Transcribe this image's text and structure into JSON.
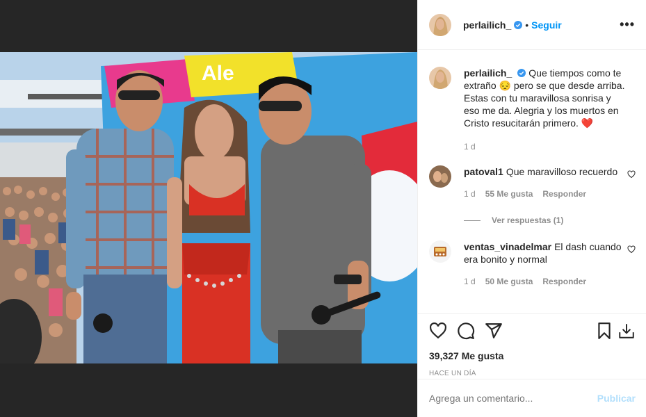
{
  "post": {
    "username": "perlailich_",
    "follow_label": "Seguir",
    "separator": "•",
    "more_label": "•••"
  },
  "caption": {
    "username": "perlailich_",
    "text": "Que tiempos como te extraño 😔 pero se que desde arriba. Estas con tu maravillosa sonrisa y eso me da. Alegria y los muertos en Cristo resucitarán primero. ❤️",
    "age": "1 d"
  },
  "comments": [
    {
      "username": "patoval1",
      "text": "Que maravilloso recuerdo",
      "age": "1 d",
      "likes": "55 Me gusta",
      "reply_label": "Responder",
      "view_replies": "Ver respuestas (1)"
    },
    {
      "username": "ventas_vinadelmar",
      "text": "El dash cuando era bonito y normal",
      "age": "1 d",
      "likes": "50 Me gusta",
      "reply_label": "Responder"
    }
  ],
  "actions": {
    "like_icon": "heart-icon",
    "comment_icon": "comment-icon",
    "share_icon": "share-icon",
    "save_icon": "bookmark-icon",
    "download_icon": "download-icon"
  },
  "likes_count": "39,327 Me gusta",
  "timestamp": "Hace un día",
  "composer": {
    "placeholder": "Agrega un comentario...",
    "post_label": "Publicar"
  },
  "colors": {
    "accent": "#0095f6",
    "post_disabled": "#b2dffc",
    "heart_red": "#ed4956",
    "muted": "#8e8e8e"
  }
}
